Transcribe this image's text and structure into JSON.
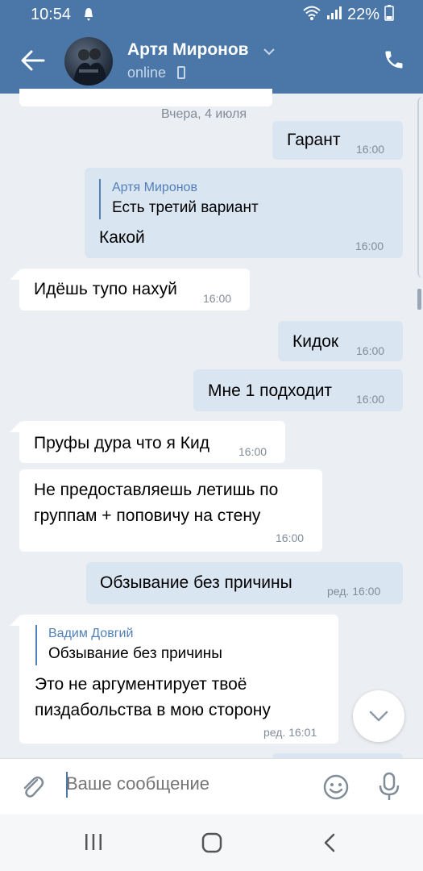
{
  "status_bar": {
    "time": "10:54",
    "battery": "22%"
  },
  "header": {
    "contact_name": "Артя Миронов",
    "status": "online"
  },
  "date_separator": "Вчера, 4 июля",
  "messages": [
    {
      "dir": "out",
      "text": "Гарант",
      "time": "16:00"
    },
    {
      "dir": "out",
      "reply_author": "Артя Миронов",
      "reply_text": "Есть третий вариант",
      "text": "Какой",
      "time": "16:00"
    },
    {
      "dir": "in",
      "text": "Идёшь тупо нахуй",
      "time": "16:00"
    },
    {
      "dir": "out",
      "text": "Кидок",
      "time": "16:00"
    },
    {
      "dir": "out",
      "text": "Мне 1 подходит",
      "time": "16:00"
    },
    {
      "dir": "in",
      "text": "Пруфы дура что я Кид",
      "time": "16:00"
    },
    {
      "dir": "in",
      "text_line1": "Не предоставляешь летишь по",
      "text_line2": "группам + поповичу на стену",
      "time": "16:00"
    },
    {
      "dir": "out",
      "text": "Обзывание без причины",
      "time": "ред. 16:00"
    },
    {
      "dir": "in",
      "reply_author": "Вадим Довгий",
      "reply_text": "Обзывание без причины",
      "text_line1": "Это не аргументирует твоё",
      "text_line2": "пиздабольства в мою сторону",
      "time": "ред. 16:01"
    }
  ],
  "compose": {
    "placeholder": "Ваше сообщение"
  },
  "icons": {
    "back": "arrow-left-icon",
    "call": "phone-icon",
    "attach": "paperclip-icon",
    "emoji": "smiley-icon",
    "mic": "microphone-icon",
    "scroll_down": "chevron-down-icon",
    "nav_recents": "recents-icon",
    "nav_home": "home-icon",
    "nav_back": "back-nav-icon"
  },
  "colors": {
    "header": "#4a76a8",
    "outgoing_bubble": "#dae5f2",
    "incoming_bubble": "#ffffff",
    "background": "#ebeef2",
    "accent": "#5181b8"
  }
}
